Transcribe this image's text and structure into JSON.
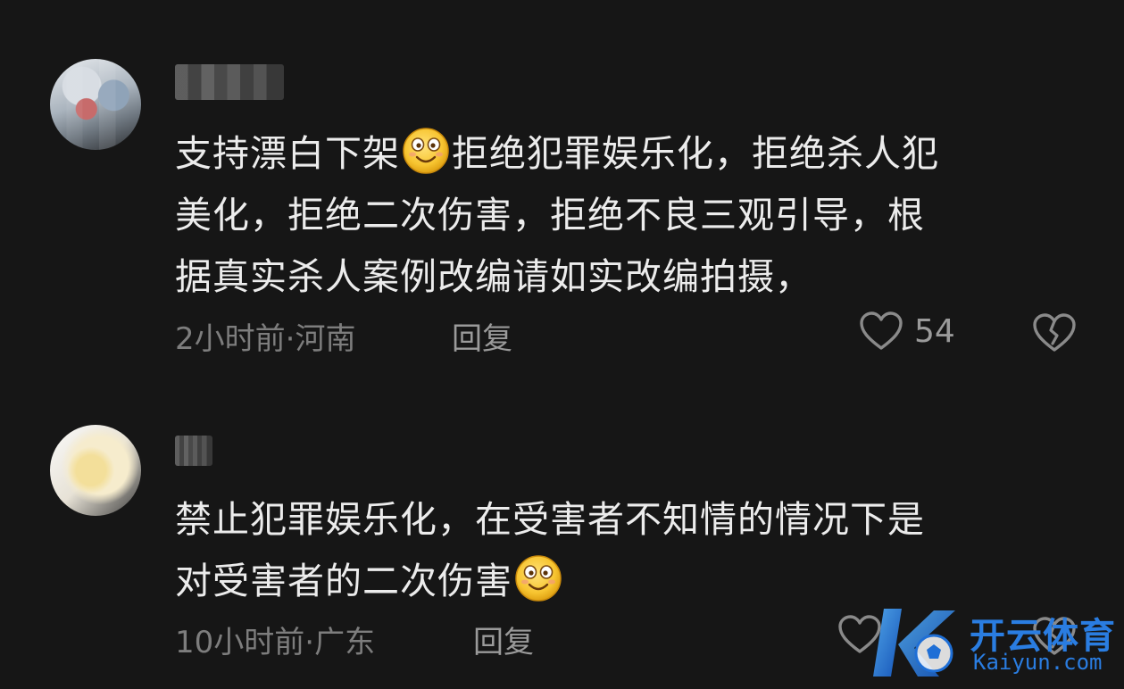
{
  "comments": [
    {
      "lines": [
        {
          "before": "支持漂白下架",
          "emoji": true,
          "after": "拒绝犯罪娱乐化，拒绝杀人犯"
        },
        {
          "before": "美化，拒绝二次伤害，拒绝不良三观引导，根",
          "emoji": false,
          "after": ""
        },
        {
          "before": "据真实杀人案例改编请如实改编拍摄，",
          "emoji": false,
          "after": ""
        }
      ],
      "meta": "2小时前·河南",
      "reply_label": "回复",
      "likes": "54"
    },
    {
      "lines": [
        {
          "before": "禁止犯罪娱乐化，在受害者不知情的情况下是",
          "emoji": false,
          "after": ""
        },
        {
          "before": "对受害者的二次伤害",
          "emoji": true,
          "after": ""
        }
      ],
      "meta": "10小时前·广东",
      "reply_label": "回复",
      "likes": ""
    }
  ],
  "watermark": {
    "cn": "开云体育",
    "en": "Kaiyun.com"
  },
  "colors": {
    "background": "#161616",
    "text": "#ececec",
    "meta": "#7d7d7d",
    "watermark": "#2a7de1"
  },
  "icons": [
    "heart-outline-icon",
    "broken-heart-icon",
    "smiley-emoji-icon"
  ]
}
